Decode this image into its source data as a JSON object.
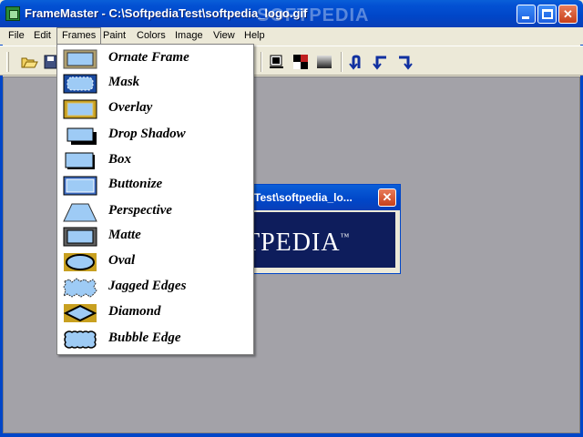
{
  "window": {
    "title": "FrameMaster - C:\\SoftpediaTest\\softpedia_logo.gif",
    "watermark": "SOFTPEDIA",
    "min_glyph": "",
    "close_glyph": "✕"
  },
  "menubar": {
    "items": [
      "File",
      "Edit",
      "Frames",
      "Paint",
      "Colors",
      "Image",
      "View",
      "Help"
    ]
  },
  "toolbar": {
    "buttons": [
      "open-icon",
      "save-icon",
      "frame-preview-icon",
      "checker-icon",
      "gradient-icon",
      "undo-arrow-icon",
      "rotate-left-icon",
      "rotate-right-icon"
    ]
  },
  "child_window": {
    "title": "iaTest\\softpedia_lo...",
    "close_glyph": "✕",
    "logo_text": "TPEDIA",
    "logo_tm": "™"
  },
  "frames_menu": {
    "items": [
      {
        "label": "Ornate Frame",
        "icon": "ornate-frame-icon"
      },
      {
        "label": "Mask",
        "icon": "mask-icon"
      },
      {
        "label": "Overlay",
        "icon": "overlay-icon"
      },
      {
        "label": "Drop Shadow",
        "icon": "drop-shadow-icon"
      },
      {
        "label": "Box",
        "icon": "box-icon"
      },
      {
        "label": "Buttonize",
        "icon": "buttonize-icon"
      },
      {
        "label": "Perspective",
        "icon": "perspective-icon"
      },
      {
        "label": "Matte",
        "icon": "matte-icon"
      },
      {
        "label": "Oval",
        "icon": "oval-icon"
      },
      {
        "label": "Jagged Edges",
        "icon": "jagged-edges-icon"
      },
      {
        "label": "Diamond",
        "icon": "diamond-icon"
      },
      {
        "label": "Bubble Edge",
        "icon": "bubble-edge-icon"
      }
    ]
  },
  "colors": {
    "accent": "#0046c8",
    "workspace": "#a3a2a8",
    "icon_fill": "#9ecbf5",
    "icon_tan": "#b0a070"
  }
}
